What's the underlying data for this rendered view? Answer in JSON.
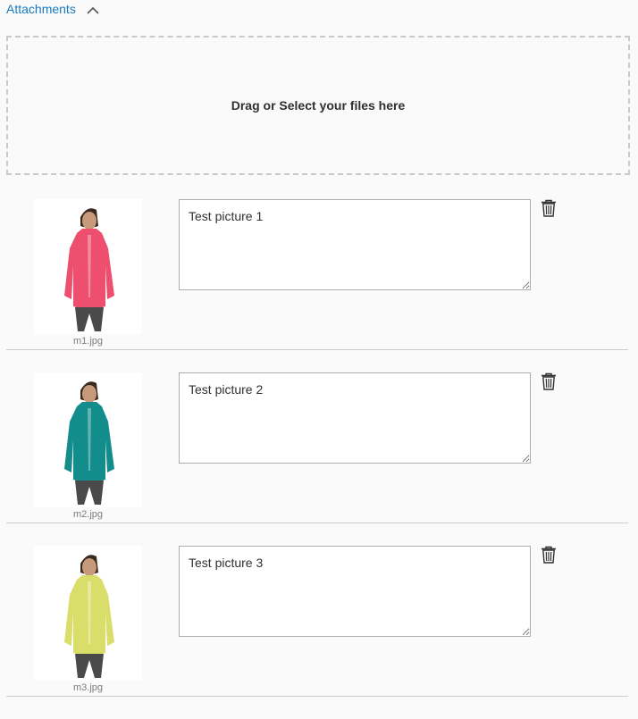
{
  "section": {
    "title": "Attachments",
    "toggle_icon": "chevron-up-icon"
  },
  "dropzone": {
    "label": "Drag or Select your files here"
  },
  "attachments": [
    {
      "filename": "m1.jpg",
      "description": "Test picture 1",
      "shirt_color": "#ee4f6e"
    },
    {
      "filename": "m2.jpg",
      "description": "Test picture 2",
      "shirt_color": "#138c8c"
    },
    {
      "filename": "m3.jpg",
      "description": "Test picture 3",
      "shirt_color": "#d9de6a"
    }
  ],
  "colors": {
    "link": "#1979c3",
    "border": "#adadad",
    "divider": "#cccccc"
  }
}
